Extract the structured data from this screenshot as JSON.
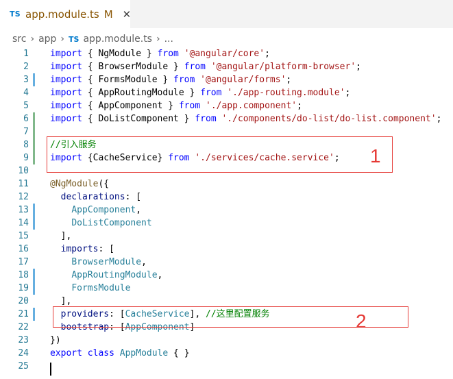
{
  "colors": {
    "accent": "#007acc",
    "modified": "#895503",
    "gutter_modified": "#66afe0",
    "gutter_added": "#81b88b",
    "annotation": "#e53935"
  },
  "tab": {
    "icon": "TS",
    "name": "app.module.ts",
    "status": "M",
    "close": "✕"
  },
  "breadcrumb": {
    "items": [
      "src",
      "app"
    ],
    "file_icon": "TS",
    "file": "app.module.ts",
    "tail": "...",
    "separator": "›"
  },
  "editor": {
    "lines": [
      {
        "n": "1",
        "gutter": "",
        "tokens": [
          [
            "kw",
            "import"
          ],
          [
            "id",
            " { NgModule } "
          ],
          [
            "kw",
            "from"
          ],
          [
            "id",
            " "
          ],
          [
            "str",
            "'@angular/core'"
          ],
          [
            "id",
            ";"
          ]
        ]
      },
      {
        "n": "2",
        "gutter": "",
        "tokens": [
          [
            "kw",
            "import"
          ],
          [
            "id",
            " { BrowserModule } "
          ],
          [
            "kw",
            "from"
          ],
          [
            "id",
            " "
          ],
          [
            "str",
            "'@angular/platform-browser'"
          ],
          [
            "id",
            ";"
          ]
        ]
      },
      {
        "n": "3",
        "gutter": "modified",
        "tokens": [
          [
            "kw",
            "import"
          ],
          [
            "id",
            " { FormsModule } "
          ],
          [
            "kw",
            "from"
          ],
          [
            "id",
            " "
          ],
          [
            "str",
            "'@angular/forms'"
          ],
          [
            "id",
            ";"
          ]
        ]
      },
      {
        "n": "4",
        "gutter": "",
        "tokens": [
          [
            "kw",
            "import"
          ],
          [
            "id",
            " { AppRoutingModule } "
          ],
          [
            "kw",
            "from"
          ],
          [
            "id",
            " "
          ],
          [
            "str",
            "'./app-routing.module'"
          ],
          [
            "id",
            ";"
          ]
        ]
      },
      {
        "n": "5",
        "gutter": "",
        "tokens": [
          [
            "kw",
            "import"
          ],
          [
            "id",
            " { AppComponent } "
          ],
          [
            "kw",
            "from"
          ],
          [
            "id",
            " "
          ],
          [
            "str",
            "'./app.component'"
          ],
          [
            "id",
            ";"
          ]
        ]
      },
      {
        "n": "6",
        "gutter": "added",
        "tokens": [
          [
            "kw",
            "import"
          ],
          [
            "id",
            " { DoListComponent } "
          ],
          [
            "kw",
            "from"
          ],
          [
            "id",
            " "
          ],
          [
            "str",
            "'./components/do-list/do-list.component'"
          ],
          [
            "id",
            ";"
          ]
        ]
      },
      {
        "n": "7",
        "gutter": "added",
        "tokens": []
      },
      {
        "n": "8",
        "gutter": "added",
        "tokens": [
          [
            "cm",
            "//引入服务"
          ]
        ]
      },
      {
        "n": "9",
        "gutter": "added",
        "tokens": [
          [
            "kw",
            "import"
          ],
          [
            "id",
            " {CacheService} "
          ],
          [
            "kw",
            "from"
          ],
          [
            "id",
            " "
          ],
          [
            "str",
            "'./services/cache.service'"
          ],
          [
            "id",
            ";"
          ]
        ]
      },
      {
        "n": "10",
        "gutter": "",
        "tokens": []
      },
      {
        "n": "11",
        "gutter": "",
        "tokens": [
          [
            "dec",
            "@NgModule"
          ],
          [
            "id",
            "({"
          ]
        ]
      },
      {
        "n": "12",
        "gutter": "",
        "tokens": [
          [
            "id",
            "  "
          ],
          [
            "prop",
            "declarations"
          ],
          [
            "id",
            ": ["
          ]
        ]
      },
      {
        "n": "13",
        "gutter": "modified",
        "tokens": [
          [
            "id",
            "    "
          ],
          [
            "cls",
            "AppComponent"
          ],
          [
            "id",
            ","
          ]
        ]
      },
      {
        "n": "14",
        "gutter": "modified",
        "tokens": [
          [
            "id",
            "    "
          ],
          [
            "cls",
            "DoListComponent"
          ]
        ]
      },
      {
        "n": "15",
        "gutter": "",
        "tokens": [
          [
            "id",
            "  ],"
          ]
        ]
      },
      {
        "n": "16",
        "gutter": "",
        "tokens": [
          [
            "id",
            "  "
          ],
          [
            "prop",
            "imports"
          ],
          [
            "id",
            ": ["
          ]
        ]
      },
      {
        "n": "17",
        "gutter": "",
        "tokens": [
          [
            "id",
            "    "
          ],
          [
            "cls",
            "BrowserModule"
          ],
          [
            "id",
            ","
          ]
        ]
      },
      {
        "n": "18",
        "gutter": "modified",
        "tokens": [
          [
            "id",
            "    "
          ],
          [
            "cls",
            "AppRoutingModule"
          ],
          [
            "id",
            ","
          ]
        ]
      },
      {
        "n": "19",
        "gutter": "modified",
        "tokens": [
          [
            "id",
            "    "
          ],
          [
            "cls",
            "FormsModule"
          ]
        ]
      },
      {
        "n": "20",
        "gutter": "",
        "tokens": [
          [
            "id",
            "  ],"
          ]
        ]
      },
      {
        "n": "21",
        "gutter": "modified",
        "tokens": [
          [
            "id",
            "  "
          ],
          [
            "prop",
            "providers"
          ],
          [
            "id",
            ": ["
          ],
          [
            "cls",
            "CacheService"
          ],
          [
            "id",
            "], "
          ],
          [
            "cm",
            "//这里配置服务"
          ]
        ]
      },
      {
        "n": "22",
        "gutter": "",
        "tokens": [
          [
            "id",
            "  "
          ],
          [
            "prop",
            "bootstrap"
          ],
          [
            "id",
            ": ["
          ],
          [
            "cls",
            "AppComponent"
          ],
          [
            "id",
            "]"
          ]
        ]
      },
      {
        "n": "23",
        "gutter": "",
        "tokens": [
          [
            "id",
            "})"
          ]
        ]
      },
      {
        "n": "24",
        "gutter": "",
        "tokens": [
          [
            "kw",
            "export"
          ],
          [
            "id",
            " "
          ],
          [
            "kw",
            "class"
          ],
          [
            "id",
            " "
          ],
          [
            "cls",
            "AppModule"
          ],
          [
            "id",
            " { }"
          ]
        ]
      },
      {
        "n": "25",
        "gutter": "",
        "tokens": []
      }
    ]
  },
  "annotations": {
    "label_1": "1",
    "label_2": "2"
  }
}
